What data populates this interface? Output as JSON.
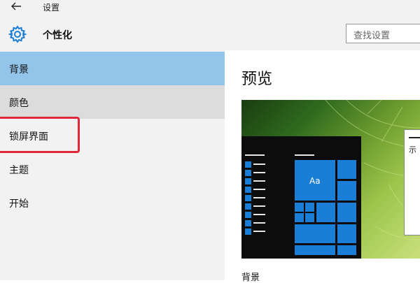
{
  "window": {
    "title": "设置",
    "back_icon": "back-arrow-icon"
  },
  "header": {
    "title": "个性化",
    "icon": "gear-icon",
    "search_placeholder": "查找设置"
  },
  "sidebar": {
    "items": [
      {
        "label": "背景",
        "state": "selected"
      },
      {
        "label": "颜色",
        "state": "hover"
      },
      {
        "label": "锁屏界面",
        "state": "highlighted"
      },
      {
        "label": "主题",
        "state": "normal"
      },
      {
        "label": "开始",
        "state": "normal"
      }
    ]
  },
  "main": {
    "preview_title": "预览",
    "tile_label": "Aa",
    "window_text": "示",
    "bottom_label": "背景"
  },
  "colors": {
    "accent": "#1a7dd6",
    "selected": "#93c5ea",
    "highlight_box": "#e0283a",
    "sidebar_bg": "#f2f2f2"
  }
}
